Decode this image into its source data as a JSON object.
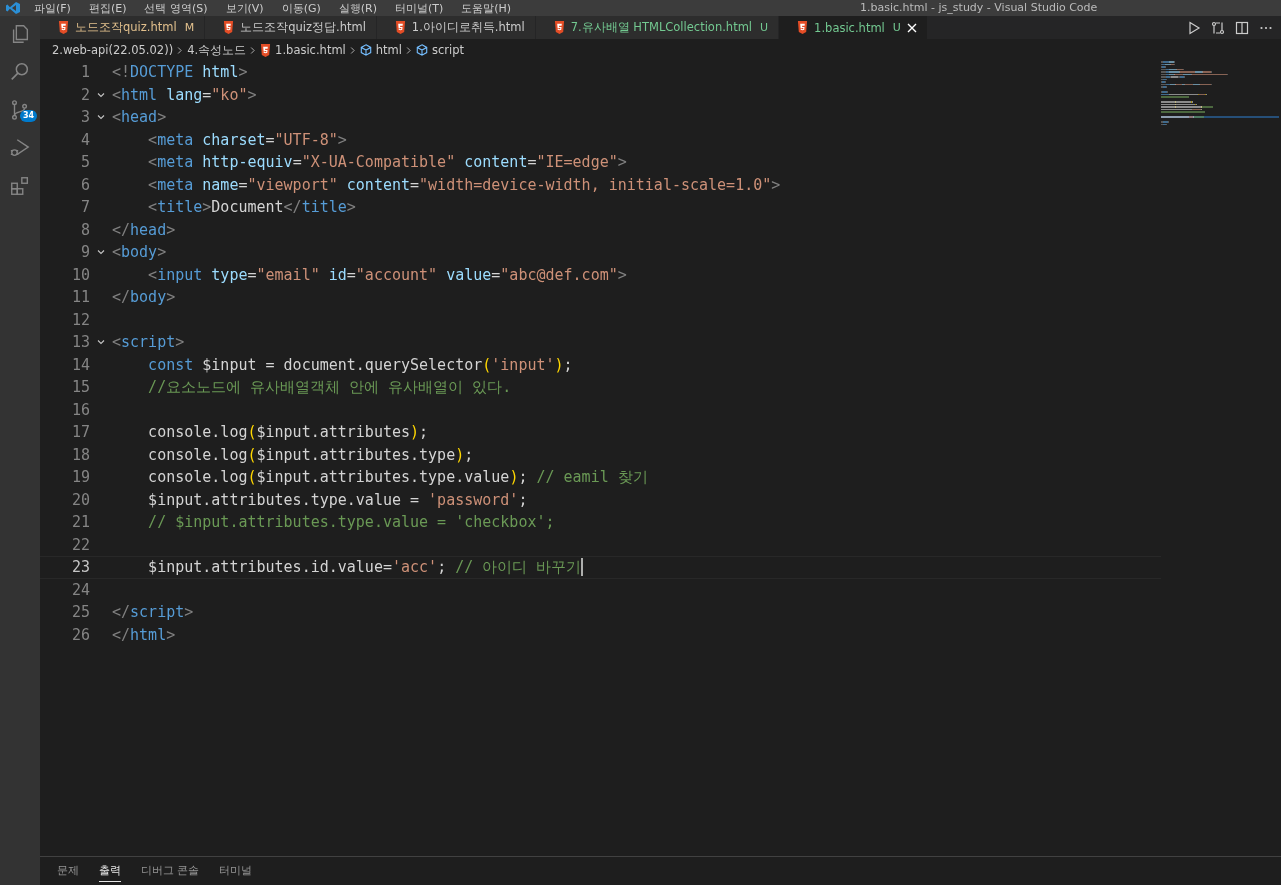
{
  "menu_bar": {
    "items": [
      "파일(F)",
      "편집(E)",
      "선택 영역(S)",
      "보기(V)",
      "이동(G)",
      "실행(R)",
      "터미널(T)",
      "도움말(H)"
    ],
    "title": "1.basic.html - js_study - Visual Studio Code"
  },
  "activity_bar": {
    "source_control_badge": "34"
  },
  "tabs": [
    {
      "label": "노드조작quiz.html",
      "badge": "M",
      "kind": "modified",
      "selected": false
    },
    {
      "label": "노드조작quiz정답.html",
      "kind": "plain",
      "selected": false
    },
    {
      "label": "1.아이디로취득.html",
      "kind": "plain",
      "selected": false
    },
    {
      "label": "7.유사배열 HTMLCollection.html",
      "badge": "U",
      "kind": "untracked",
      "selected": false
    },
    {
      "label": "1.basic.html",
      "badge": "U",
      "kind": "untracked",
      "selected": true
    }
  ],
  "breadcrumbs": [
    {
      "label": "2.web-api(22.05.02))",
      "kind": "folder"
    },
    {
      "label": "4.속성노드",
      "kind": "folder"
    },
    {
      "label": "1.basic.html",
      "kind": "file"
    },
    {
      "label": "html",
      "kind": "symbol"
    },
    {
      "label": "script",
      "kind": "symbol"
    }
  ],
  "editor": {
    "lines": [
      {
        "number": "1",
        "foldable": false,
        "current": false,
        "tokens": [
          {
            "kind": "p",
            "text": "<!"
          },
          {
            "kind": "tag",
            "text": "DOCTYPE"
          },
          {
            "kind": "attr",
            "text": " html"
          },
          {
            "kind": "p",
            "text": ">"
          }
        ]
      },
      {
        "number": "2",
        "foldable": true,
        "current": false,
        "tokens": [
          {
            "kind": "p",
            "text": "<"
          },
          {
            "kind": "tag",
            "text": "html"
          },
          {
            "kind": "attr",
            "text": " lang"
          },
          {
            "kind": "t",
            "text": "="
          },
          {
            "kind": "str",
            "text": "\"ko\""
          },
          {
            "kind": "p",
            "text": ">"
          }
        ]
      },
      {
        "number": "3",
        "foldable": true,
        "current": false,
        "tokens": [
          {
            "kind": "p",
            "text": "<"
          },
          {
            "kind": "tag",
            "text": "head"
          },
          {
            "kind": "p",
            "text": ">"
          }
        ]
      },
      {
        "number": "4",
        "foldable": false,
        "current": false,
        "tokens": [
          {
            "kind": "p",
            "text": "    <"
          },
          {
            "kind": "tag",
            "text": "meta"
          },
          {
            "kind": "attr",
            "text": " charset"
          },
          {
            "kind": "t",
            "text": "="
          },
          {
            "kind": "str",
            "text": "\"UTF-8\""
          },
          {
            "kind": "p",
            "text": ">"
          }
        ]
      },
      {
        "number": "5",
        "foldable": false,
        "current": false,
        "tokens": [
          {
            "kind": "p",
            "text": "    <"
          },
          {
            "kind": "tag",
            "text": "meta"
          },
          {
            "kind": "attr",
            "text": " http-equiv"
          },
          {
            "kind": "t",
            "text": "="
          },
          {
            "kind": "str",
            "text": "\"X-UA-Compatible\""
          },
          {
            "kind": "attr",
            "text": " content"
          },
          {
            "kind": "t",
            "text": "="
          },
          {
            "kind": "str",
            "text": "\"IE=edge\""
          },
          {
            "kind": "p",
            "text": ">"
          }
        ]
      },
      {
        "number": "6",
        "foldable": false,
        "current": false,
        "tokens": [
          {
            "kind": "p",
            "text": "    <"
          },
          {
            "kind": "tag",
            "text": "meta"
          },
          {
            "kind": "attr",
            "text": " name"
          },
          {
            "kind": "t",
            "text": "="
          },
          {
            "kind": "str",
            "text": "\"viewport\""
          },
          {
            "kind": "attr",
            "text": " content"
          },
          {
            "kind": "t",
            "text": "="
          },
          {
            "kind": "str",
            "text": "\"width=device-width, initial-scale=1.0\""
          },
          {
            "kind": "p",
            "text": ">"
          }
        ]
      },
      {
        "number": "7",
        "foldable": false,
        "current": false,
        "tokens": [
          {
            "kind": "p",
            "text": "    <"
          },
          {
            "kind": "tag",
            "text": "title"
          },
          {
            "kind": "p",
            "text": ">"
          },
          {
            "kind": "t",
            "text": "Document"
          },
          {
            "kind": "p",
            "text": "</"
          },
          {
            "kind": "tag",
            "text": "title"
          },
          {
            "kind": "p",
            "text": ">"
          }
        ]
      },
      {
        "number": "8",
        "foldable": false,
        "current": false,
        "tokens": [
          {
            "kind": "p",
            "text": "</"
          },
          {
            "kind": "tag",
            "text": "head"
          },
          {
            "kind": "p",
            "text": ">"
          }
        ]
      },
      {
        "number": "9",
        "foldable": true,
        "current": false,
        "tokens": [
          {
            "kind": "p",
            "text": "<"
          },
          {
            "kind": "tag",
            "text": "body"
          },
          {
            "kind": "p",
            "text": ">"
          }
        ]
      },
      {
        "number": "10",
        "foldable": false,
        "current": false,
        "tokens": [
          {
            "kind": "p",
            "text": "    <"
          },
          {
            "kind": "tag",
            "text": "input"
          },
          {
            "kind": "attr",
            "text": " type"
          },
          {
            "kind": "t",
            "text": "="
          },
          {
            "kind": "str",
            "text": "\"email\""
          },
          {
            "kind": "attr",
            "text": " id"
          },
          {
            "kind": "t",
            "text": "="
          },
          {
            "kind": "str",
            "text": "\"account\""
          },
          {
            "kind": "attr",
            "text": " value"
          },
          {
            "kind": "t",
            "text": "="
          },
          {
            "kind": "str",
            "text": "\"abc@def.com\""
          },
          {
            "kind": "p",
            "text": ">"
          }
        ]
      },
      {
        "number": "11",
        "foldable": false,
        "current": false,
        "tokens": [
          {
            "kind": "p",
            "text": "</"
          },
          {
            "kind": "tag",
            "text": "body"
          },
          {
            "kind": "p",
            "text": ">"
          }
        ]
      },
      {
        "number": "12",
        "foldable": false,
        "current": false
      },
      {
        "number": "13",
        "foldable": true,
        "current": false,
        "tokens": [
          {
            "kind": "p",
            "text": "<"
          },
          {
            "kind": "tag",
            "text": "script"
          },
          {
            "kind": "p",
            "text": ">"
          }
        ]
      },
      {
        "number": "14",
        "foldable": false,
        "current": false,
        "tokens": [
          {
            "kind": "kw",
            "text": "    const"
          },
          {
            "kind": "t",
            "text": " $input = document.querySelector"
          },
          {
            "kind": "br",
            "text": "("
          },
          {
            "kind": "str",
            "text": "'input'"
          },
          {
            "kind": "br",
            "text": ")"
          },
          {
            "kind": "t",
            "text": ";"
          }
        ]
      },
      {
        "number": "15",
        "foldable": false,
        "current": false,
        "tokens": [
          {
            "kind": "cm",
            "text": "    //요소노드에 유사배열객체 안에 유사배열이 있다."
          }
        ]
      },
      {
        "number": "16",
        "foldable": false,
        "current": false
      },
      {
        "number": "17",
        "foldable": false,
        "current": false,
        "tokens": [
          {
            "kind": "t",
            "text": "    console.log"
          },
          {
            "kind": "br",
            "text": "("
          },
          {
            "kind": "t",
            "text": "$input.attributes"
          },
          {
            "kind": "br",
            "text": ")"
          },
          {
            "kind": "t",
            "text": ";"
          }
        ]
      },
      {
        "number": "18",
        "foldable": false,
        "current": false,
        "tokens": [
          {
            "kind": "t",
            "text": "    console.log"
          },
          {
            "kind": "br",
            "text": "("
          },
          {
            "kind": "t",
            "text": "$input.attributes.type"
          },
          {
            "kind": "br",
            "text": ")"
          },
          {
            "kind": "t",
            "text": ";"
          }
        ]
      },
      {
        "number": "19",
        "foldable": false,
        "current": false,
        "tokens": [
          {
            "kind": "t",
            "text": "    console.log"
          },
          {
            "kind": "br",
            "text": "("
          },
          {
            "kind": "t",
            "text": "$input.attributes.type.value"
          },
          {
            "kind": "br",
            "text": ")"
          },
          {
            "kind": "t",
            "text": ";"
          },
          {
            "kind": "cm",
            "text": " // eamil 찾기"
          }
        ]
      },
      {
        "number": "20",
        "foldable": false,
        "current": false,
        "tokens": [
          {
            "kind": "t",
            "text": "    $input.attributes.type.value ="
          },
          {
            "kind": "str",
            "text": " 'password'"
          },
          {
            "kind": "t",
            "text": ";"
          }
        ]
      },
      {
        "number": "21",
        "foldable": false,
        "current": false,
        "tokens": [
          {
            "kind": "cm",
            "text": "    // $input.attributes.type.value = 'checkbox';"
          }
        ]
      },
      {
        "number": "22",
        "foldable": false,
        "current": false
      },
      {
        "number": "23",
        "foldable": false,
        "current": true,
        "tokens": [
          {
            "kind": "t",
            "text": "    $input.attributes.id.value="
          },
          {
            "kind": "str",
            "text": "'acc'"
          },
          {
            "kind": "t",
            "text": ";"
          },
          {
            "kind": "cm",
            "text": " // 아이디 바꾸기"
          }
        ]
      },
      {
        "number": "24",
        "foldable": false,
        "current": false
      },
      {
        "number": "25",
        "foldable": false,
        "current": false,
        "tokens": [
          {
            "kind": "p",
            "text": "</"
          },
          {
            "kind": "tag",
            "text": "script"
          },
          {
            "kind": "p",
            "text": ">"
          }
        ]
      },
      {
        "number": "26",
        "foldable": false,
        "current": false,
        "tokens": [
          {
            "kind": "p",
            "text": "</"
          },
          {
            "kind": "tag",
            "text": "html"
          },
          {
            "kind": "p",
            "text": ">"
          }
        ]
      }
    ]
  },
  "panel_tabs": [
    {
      "label": "문제",
      "selected": false
    },
    {
      "label": "출력",
      "selected": true
    },
    {
      "label": "디버그 콘솔",
      "selected": false
    },
    {
      "label": "터미널",
      "selected": false
    }
  ]
}
